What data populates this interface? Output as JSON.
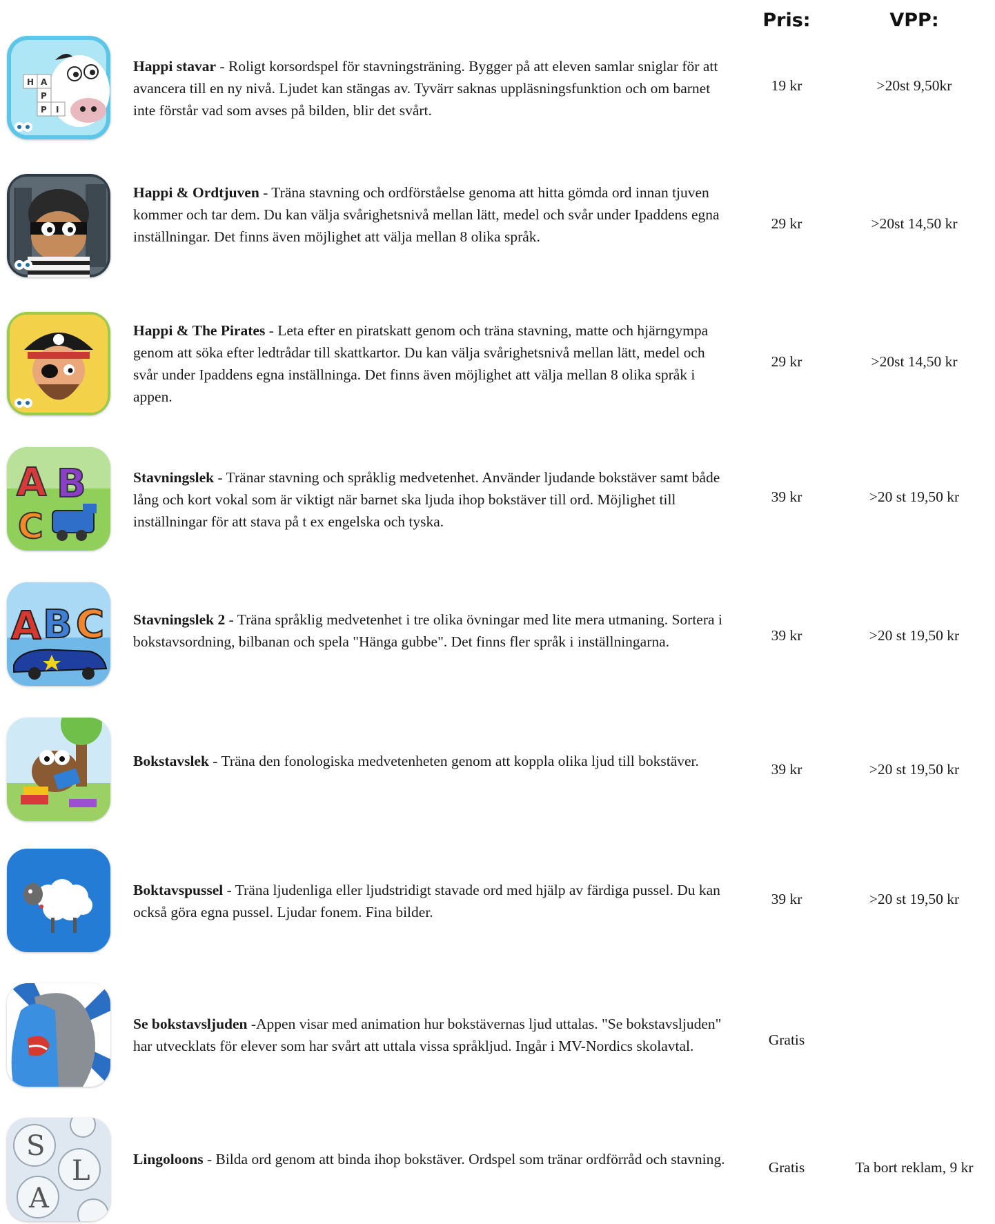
{
  "headers": {
    "price": "Pris:",
    "vpp": "VPP:"
  },
  "apps": [
    {
      "name": "Happi stavar",
      "description": " - Roligt korsordspel för stavningsträning. Bygger på att eleven samlar sniglar för att avancera till en ny nivå. Ljudet kan stängas av. Tyvärr saknas uppläsningsfunktion och om barnet inte förstår vad som avses på bilden, blir det svårt.",
      "price": "19 kr",
      "vpp": ">20st 9,50kr",
      "icon": "cow-crossword-icon"
    },
    {
      "name": "Happi & Ordtjuven",
      "description": " -  Träna stavning och ordförståelse genoma att hitta gömda ord innan tjuven kommer och tar dem. Du kan välja svårighetsnivå mellan lätt, medel och svår under Ipaddens egna inställningar. Det finns även möjlighet att välja mellan 8 olika språk.",
      "price": "29 kr",
      "vpp": ">20st 14,50 kr",
      "icon": "thief-icon"
    },
    {
      "name": "Happi & The Pirates",
      "description": " - Leta efter en piratskatt genom och träna stavning, matte och hjärngympa genom att söka efter ledtrådar till skattkartor. Du kan välja svårighetsnivå mellan lätt, medel och svår under Ipaddens egna inställninga. Det finns även möjlighet att välja mellan 8 olika språk i appen.",
      "price": "29 kr",
      "vpp": ">20st 14,50 kr",
      "icon": "pirate-icon"
    },
    {
      "name": "Stavningslek",
      "description": " - Tränar stavning och språklig medvetenhet. Använder ljudande bokstäver samt både lång och kort vokal som är viktigt när barnet ska ljuda ihop bokstäver till ord. Möjlighet till inställningar för att stava på t ex engelska och tyska.",
      "price": "39 kr",
      "vpp": ">20 st 19,50 kr",
      "icon": "abc-train-icon"
    },
    {
      "name": "Stavningslek 2",
      "description": " - Träna språklig medvetenhet  i tre olika övningar med lite mera utmaning. Sortera i bokstavsordning, bilbanan och spela \"Hänga gubbe\". Det finns fler språk i inställningarna.",
      "price": "39 kr",
      "vpp": ">20 st 19,50 kr",
      "icon": "abc-car-icon"
    },
    {
      "name": "Bokstavslek",
      "description": " - Träna den fonologiska medvetenheten genom att koppla olika ljud till bokstäver.",
      "price": "39 kr",
      "vpp": ">20 st 19,50 kr",
      "icon": "owl-reading-icon"
    },
    {
      "name": "Boktavspussel",
      "description": " - Träna ljudenliga eller ljudstridigt stavade ord med hjälp av färdiga pussel. Du kan också göra egna pussel. Ljudar fonem. Fina bilder.",
      "price": "39 kr",
      "vpp": ">20 st 19,50 kr",
      "icon": "sheep-icon"
    },
    {
      "name": "Se bokstavsljuden",
      "description": " -Appen visar med animation hur bokstävernas ljud uttalas. \"Se bokstavsljuden\" har utvecklats för elever som har svårt att uttala vissa språkljud. Ingår i MV-Nordics skolavtal.",
      "price": "Gratis",
      "vpp": "",
      "icon": "mouth-profile-icon"
    },
    {
      "name": "Lingoloons",
      "description": " - Bilda ord genom att binda ihop bokstäver. Ordspel som tränar ordförråd och stavning.",
      "price": "Gratis",
      "vpp": "Ta bort reklam, 9 kr",
      "icon": "letter-bubbles-icon"
    }
  ]
}
